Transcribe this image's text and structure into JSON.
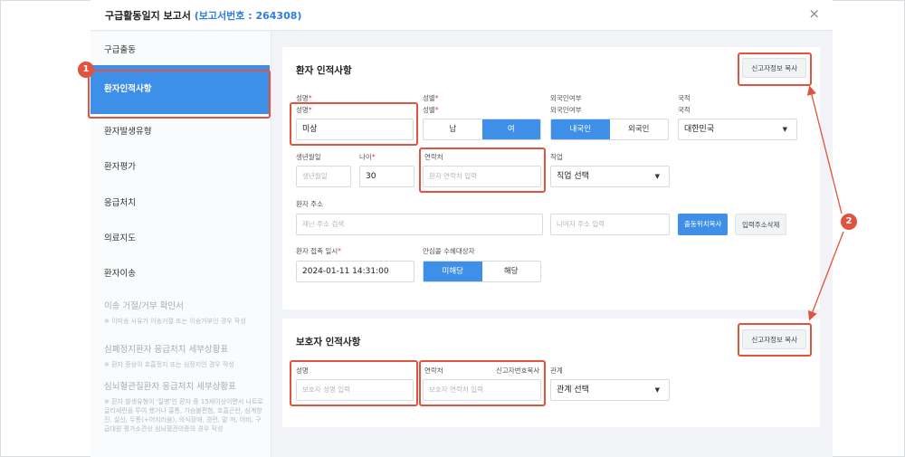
{
  "title": {
    "main": "구급활동일지 보고서",
    "report": "(보고서번호 : 264308)"
  },
  "close_glyph": "×",
  "sidebar": {
    "items": [
      {
        "label": "구급출동"
      },
      {
        "label": "환자인적사항"
      },
      {
        "label": "환자발생유형"
      },
      {
        "label": "환자평가"
      },
      {
        "label": "응급처치"
      },
      {
        "label": "의료지도"
      },
      {
        "label": "환자이송"
      }
    ],
    "disabled": [
      {
        "label": "이송 거절/거부 확인서",
        "sub": "※ 이미송 사유가 이송거절 또는 이송거부인 경우 작성"
      },
      {
        "label": "심폐정지환자 응급처치 세부상황표",
        "sub": "※ 환자 증상이 호흡정지 또는 심정지인 경우 작성"
      },
      {
        "label": "심뇌혈관질환자 응급처치 세부상황표",
        "sub": "※ 환자 발생유형이 '질병'인 환자 중 15세이상이면서 나트로글리세린을 투여 했거나 흉통, 가슴불편함, 호흡곤란, 심계항진, 실신, 두통(+어지러움), 의식장애, 경련, 말 져, 어비, 구급대원 평가소견상 심뇌혈관의증의 경우 작성"
      }
    ]
  },
  "patient": {
    "title": "환자 인적사항",
    "copy_label": "신고자정보 복사",
    "name": {
      "label": "성명",
      "value": "미상"
    },
    "gender": {
      "label": "성별",
      "male": "남",
      "female": "여",
      "selected": "여"
    },
    "foreign": {
      "label": "외국인여부",
      "native": "내국인",
      "foreigner": "외국인",
      "selected": "내국인"
    },
    "nationality": {
      "label": "국적",
      "value": "대한민국"
    },
    "birth": {
      "label": "생년월일",
      "placeholder": "생년월일"
    },
    "age": {
      "label": "나이",
      "value": "30"
    },
    "contact": {
      "label": "연락처",
      "placeholder": "환자 연락처 입력"
    },
    "job": {
      "label": "직업",
      "value": "직업 선택"
    },
    "address": {
      "label": "환자 주소",
      "search_placeholder": "재난 주소 검색",
      "rest_placeholder": "나머지 주소 입력",
      "copy_location": "출동위치복사",
      "delete_address": "입력주소삭제"
    },
    "contact_time": {
      "label": "환자 접촉 일시",
      "value": "2024-01-11 14:31:00"
    },
    "relief": {
      "label": "안심콜 수혜대상자",
      "no": "미해당",
      "yes": "해당",
      "selected": "미해당"
    }
  },
  "guardian": {
    "title": "보호자 인적사항",
    "copy_label": "신고자정보 복사",
    "name": {
      "label": "성명",
      "placeholder": "보호자 성명 입력"
    },
    "contact": {
      "label": "연락처",
      "copy_link": "신고자번호복사",
      "placeholder": "보호자 연락처 입력"
    },
    "relation": {
      "label": "관계",
      "value": "관계 선택"
    }
  },
  "annotations": {
    "badge1": "1",
    "badge2": "2"
  },
  "colors": {
    "accent": "#3d8fe8",
    "highlight": "#e0533f",
    "required": "#e0334b"
  },
  "icons": {
    "caret": "▼"
  }
}
